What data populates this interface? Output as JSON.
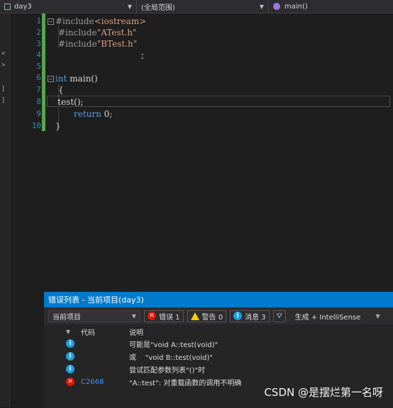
{
  "navbar": {
    "project": "day3",
    "scope": "(全局范围)",
    "member": "main()"
  },
  "editor": {
    "line_numbers": [
      "1",
      "2",
      "3",
      "4",
      "5",
      "6",
      "7",
      "8",
      "9",
      "10"
    ],
    "lines": [
      {
        "pre": "#include",
        "arg": "<iostream>"
      },
      {
        "pre": "#include",
        "arg": "\"ATest.h\""
      },
      {
        "pre": "#include",
        "arg": "\"BTest.h\""
      },
      {
        "kw": "int",
        "rest": " main()"
      },
      {
        "text": "{"
      },
      {
        "text": "    test();"
      },
      {
        "kw": "return",
        "rest": " 0;"
      },
      {
        "text": "}"
      }
    ]
  },
  "error_list": {
    "title": "错误列表 - 当前项目(day3)",
    "scope": "当前项目",
    "errors_label": "错误 1",
    "warnings_label": "警告 0",
    "messages_label": "消息 3",
    "build_filter": "生成 + IntelliSense",
    "col_code": "代码",
    "col_desc": "说明",
    "rows": [
      {
        "type": "info",
        "code": "",
        "desc": "可能是\"void A::test(void)\""
      },
      {
        "type": "info",
        "code": "",
        "desc": "或    \"void B::test(void)\""
      },
      {
        "type": "info",
        "code": "",
        "desc": "尝试匹配参数列表\"()\"时"
      },
      {
        "type": "error",
        "code": "C2668",
        "desc": "\"A::test\": 对重载函数的调用不明确"
      }
    ]
  },
  "watermark": "CSDN @是摆烂第一名呀"
}
